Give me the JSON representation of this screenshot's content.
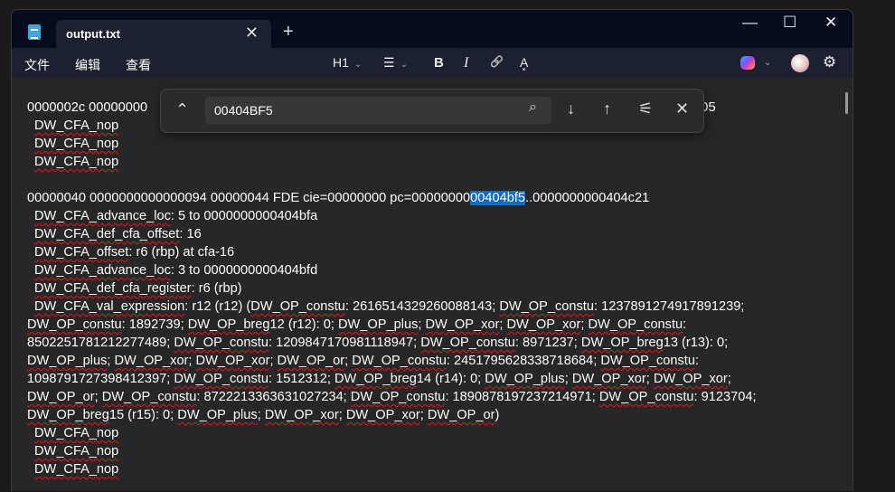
{
  "window": {
    "tab_title": "output.txt",
    "new_tab": "+",
    "tab_close": "✕",
    "minimize": "—",
    "maximize": "☐",
    "close": "✕"
  },
  "menu": {
    "file": "文件",
    "edit": "编辑",
    "view": "查看"
  },
  "toolbar": {
    "heading": "H1",
    "list": "☰",
    "bold": "B",
    "italic": "I",
    "link": "🔗",
    "spellcheck": "A͓",
    "chevron": "⌄",
    "settings": "⚙"
  },
  "find": {
    "value": "00404BF5",
    "collapse": "⌃",
    "search": "⌕",
    "next": "↓",
    "prev": "↑",
    "options": "⚟",
    "close": "✕"
  },
  "document": {
    "line_hidden_head": "0000002c 00000000",
    "line_hidden_tail": "05",
    "lines": [
      {
        "text": "",
        "indent": false
      },
      {
        "text": "DW_CFA_nop",
        "indent": true
      },
      {
        "text": "DW_CFA_nop",
        "indent": true
      },
      {
        "text": "DW_CFA_nop",
        "indent": true
      },
      {
        "text": "",
        "indent": false
      },
      {
        "text": "00000040 0000000000000094 00000044 FDE cie=00000000 pc=0000000000404bf5..0000000000404c21",
        "indent": false,
        "highlight": "00404bf5"
      },
      {
        "text": "DW_CFA_advance_loc: 5 to 0000000000404bfa",
        "indent": true
      },
      {
        "text": "DW_CFA_def_cfa_offset: 16",
        "indent": true
      },
      {
        "text": "DW_CFA_offset: r6 (rbp) at cfa-16",
        "indent": true
      },
      {
        "text": "DW_CFA_advance_loc: 3 to 0000000000404bfd",
        "indent": true
      },
      {
        "text": "DW_CFA_def_cfa_register: r6 (rbp)",
        "indent": true
      },
      {
        "text": "DW_CFA_val_expression: r12 (r12) (DW_OP_constu: 2616514329260088143; DW_OP_constu: 1237891274917891239;",
        "indent": true
      },
      {
        "text": "DW_OP_constu: 1892739; DW_OP_breg12 (r12): 0; DW_OP_plus; DW_OP_xor; DW_OP_xor; DW_OP_constu:",
        "indent": false
      },
      {
        "text": "8502251781212277489; DW_OP_constu: 1209847170981118947; DW_OP_constu: 8971237; DW_OP_breg13 (r13): 0;",
        "indent": false
      },
      {
        "text": "DW_OP_plus; DW_OP_xor; DW_OP_xor; DW_OP_or; DW_OP_constu: 2451795628338718684; DW_OP_constu:",
        "indent": false
      },
      {
        "text": "1098791727398412397; DW_OP_constu: 1512312; DW_OP_breg14 (r14): 0; DW_OP_plus; DW_OP_xor; DW_OP_xor;",
        "indent": false
      },
      {
        "text": "DW_OP_or; DW_OP_constu: 8722213363631027234; DW_OP_constu: 1890878197237214971; DW_OP_constu: 9123704;",
        "indent": false
      },
      {
        "text": "DW_OP_breg15 (r15): 0; DW_OP_plus; DW_OP_xor; DW_OP_xor; DW_OP_or)",
        "indent": false
      },
      {
        "text": "DW_CFA_nop",
        "indent": true
      },
      {
        "text": "DW_CFA_nop",
        "indent": true
      },
      {
        "text": "DW_CFA_nop",
        "indent": true
      }
    ]
  }
}
